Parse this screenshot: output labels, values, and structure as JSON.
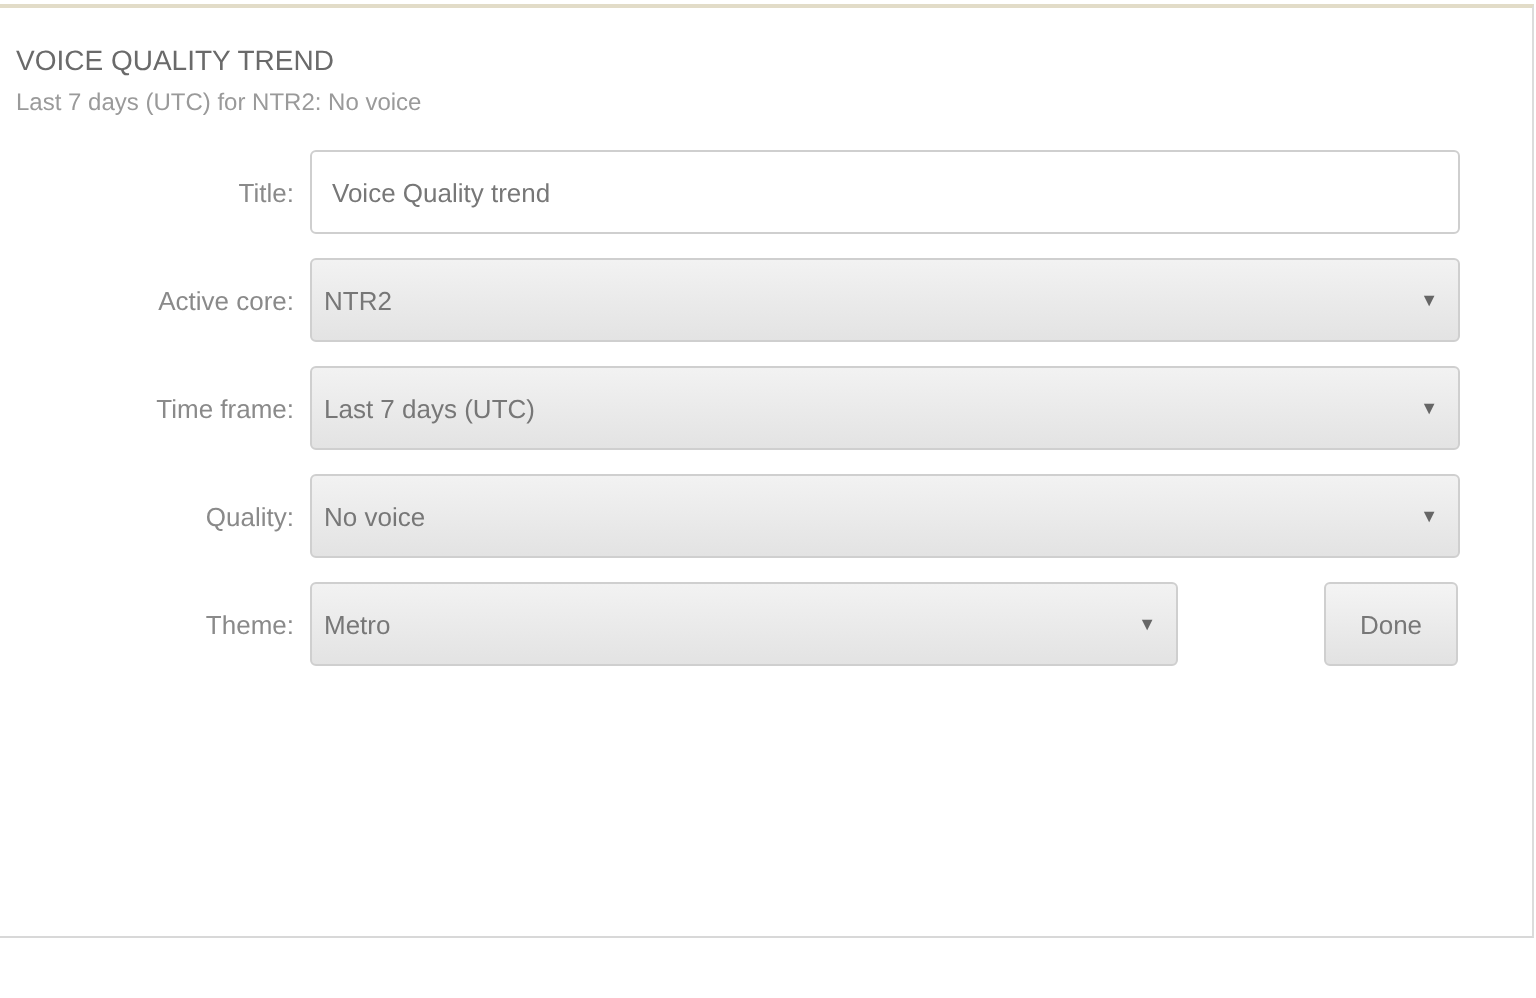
{
  "panel": {
    "title": "VOICE QUALITY TREND",
    "subtitle": "Last 7 days (UTC) for NTR2: No voice"
  },
  "fields": [
    {
      "kind": "text",
      "label": "Title:",
      "value": "Voice Quality trend"
    },
    {
      "kind": "select",
      "label": "Active core:",
      "value": "NTR2",
      "caret": "▼"
    },
    {
      "kind": "select",
      "label": "Time frame:",
      "value": "Last 7 days (UTC)",
      "caret": "▼"
    },
    {
      "kind": "select",
      "label": "Quality:",
      "value": "No voice",
      "caret": "▼"
    },
    {
      "kind": "select_short",
      "label": "Theme:",
      "value": "Metro",
      "caret": "▼",
      "button": "Done"
    }
  ]
}
